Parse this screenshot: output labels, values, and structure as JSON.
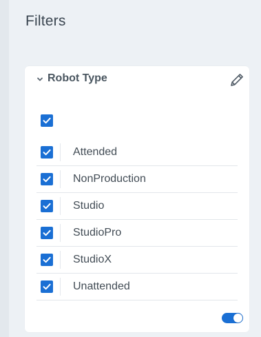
{
  "page": {
    "title": "Filters"
  },
  "filter_card": {
    "title": "Robot Type",
    "select_all_checked": true,
    "options": [
      {
        "label": "Attended",
        "checked": true
      },
      {
        "label": "NonProduction",
        "checked": true
      },
      {
        "label": "Studio",
        "checked": true
      },
      {
        "label": "StudioPro",
        "checked": true
      },
      {
        "label": "StudioX",
        "checked": true
      },
      {
        "label": "Unattended",
        "checked": true
      }
    ],
    "toggle_on": true
  },
  "icons": {
    "collapse": "chevron-down-icon",
    "edit": "pencil-icon",
    "check": "check-icon"
  },
  "colors": {
    "accent": "#1a6fd4",
    "background": "#edf1f5",
    "card": "#ffffff",
    "text": "#414b54"
  }
}
